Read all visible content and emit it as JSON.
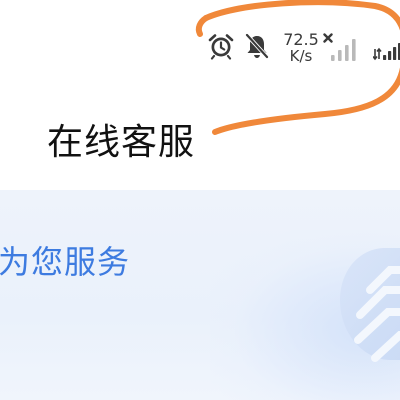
{
  "status_bar": {
    "icons": [
      "alarm-icon",
      "notifications-off-icon",
      "mobile-signal-icon",
      "mobile-signal-icon"
    ],
    "network_speed_value": "72.5",
    "network_speed_unit": "K/s"
  },
  "header": {
    "title": "在线客服"
  },
  "banner": {
    "text": "为您服务"
  },
  "colors": {
    "annotation": "#f0883a",
    "banner_text": "#3d7be0",
    "banner_bg": "#eef3fb",
    "status_icons": "#3a3a3a"
  }
}
